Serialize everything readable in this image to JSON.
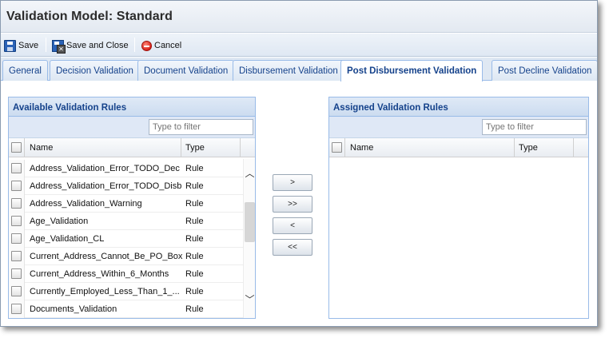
{
  "window": {
    "title": "Validation Model: Standard"
  },
  "toolbar": {
    "save_label": "Save",
    "save_close_label": "Save and Close",
    "cancel_label": "Cancel"
  },
  "tabs": [
    {
      "label": "General",
      "active": false
    },
    {
      "label": "Decision Validation",
      "active": false
    },
    {
      "label": "Document Validation",
      "active": false
    },
    {
      "label": "Disbursement Validation",
      "active": false
    },
    {
      "label": "Post Disbursement Validation",
      "active": true
    },
    {
      "label": "Post Decline Validation",
      "active": false
    }
  ],
  "available": {
    "title": "Available Validation Rules",
    "filter_placeholder": "Type to filter",
    "columns": {
      "name": "Name",
      "type": "Type"
    },
    "rows": [
      {
        "name": "Address_Validation_Error_TODO_Dec",
        "type": "Rule"
      },
      {
        "name": "Address_Validation_Error_TODO_Disb",
        "type": "Rule"
      },
      {
        "name": "Address_Validation_Warning",
        "type": "Rule"
      },
      {
        "name": "Age_Validation",
        "type": "Rule"
      },
      {
        "name": "Age_Validation_CL",
        "type": "Rule"
      },
      {
        "name": "Current_Address_Cannot_Be_PO_Box",
        "type": "Rule"
      },
      {
        "name": "Current_Address_Within_6_Months",
        "type": "Rule"
      },
      {
        "name": "Currently_Employed_Less_Than_1_...",
        "type": "Rule"
      },
      {
        "name": "Documents_Validation",
        "type": "Rule"
      }
    ]
  },
  "assigned": {
    "title": "Assigned Validation Rules",
    "filter_placeholder": "Type to filter",
    "columns": {
      "name": "Name",
      "type": "Type"
    },
    "rows": []
  },
  "move_buttons": {
    "add": ">",
    "add_all": ">>",
    "remove": "<",
    "remove_all": "<<"
  },
  "icons": {
    "save": "floppy-disk-icon",
    "save_close": "floppy-close-icon",
    "cancel": "cancel-circle-icon",
    "scroll_up": "chevron-up-icon",
    "scroll_down": "chevron-down-icon"
  },
  "colors": {
    "tab_text": "#15428b",
    "panel_border": "#99bbe8",
    "header_bg": "#dfe9f6"
  }
}
